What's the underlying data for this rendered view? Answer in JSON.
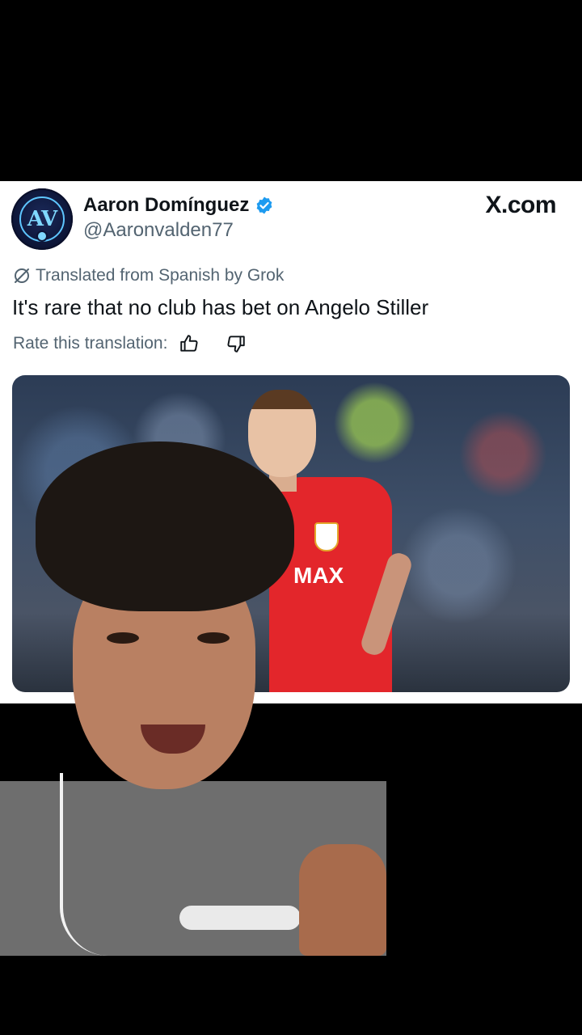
{
  "tweet": {
    "display_name": "Aaron Domínguez",
    "handle": "@Aaronvalden77",
    "avatar_initials": "AV",
    "brand": "X.com",
    "translated_label": "Translated from Spanish by Grok",
    "text": "It's rare that no club has bet on Angelo Stiller",
    "rate_label": "Rate this translation:",
    "media": {
      "shirt_text": "MAX"
    }
  },
  "colors": {
    "verified": "#1d9bf0",
    "primary_text": "#0f1419",
    "secondary_text": "#536471"
  },
  "icons": [
    "verified-badge-icon",
    "grok-translate-icon",
    "thumbs-up-icon",
    "thumbs-down-icon"
  ]
}
